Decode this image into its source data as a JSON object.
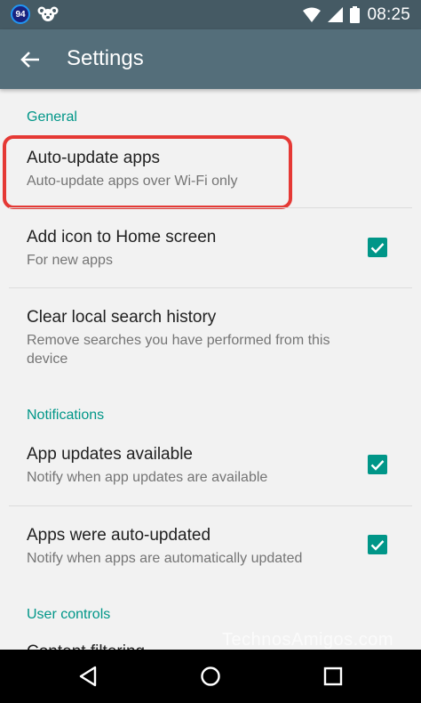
{
  "status_bar": {
    "badge": "94",
    "time": "08:25"
  },
  "app_bar": {
    "title": "Settings"
  },
  "sections": {
    "general": {
      "header": "General"
    },
    "notifications": {
      "header": "Notifications"
    },
    "user_controls": {
      "header": "User controls"
    }
  },
  "prefs": {
    "auto_update": {
      "title": "Auto-update apps",
      "summary": "Auto-update apps over Wi-Fi only"
    },
    "add_icon": {
      "title": "Add icon to Home screen",
      "summary": "For new apps",
      "checked": true
    },
    "clear_history": {
      "title": "Clear local search history",
      "summary": "Remove searches you have performed from this device"
    },
    "app_updates": {
      "title": "App updates available",
      "summary": "Notify when app updates are available",
      "checked": true
    },
    "auto_updated": {
      "title": "Apps were auto-updated",
      "summary": "Notify when apps are automatically updated",
      "checked": true
    },
    "content_filtering": {
      "title": "Content filtering"
    }
  },
  "watermark": "TechnosAmigos.com",
  "colors": {
    "status_bar": "#455a64",
    "app_bar": "#546e7a",
    "accent": "#009688",
    "highlight": "#e53935"
  }
}
